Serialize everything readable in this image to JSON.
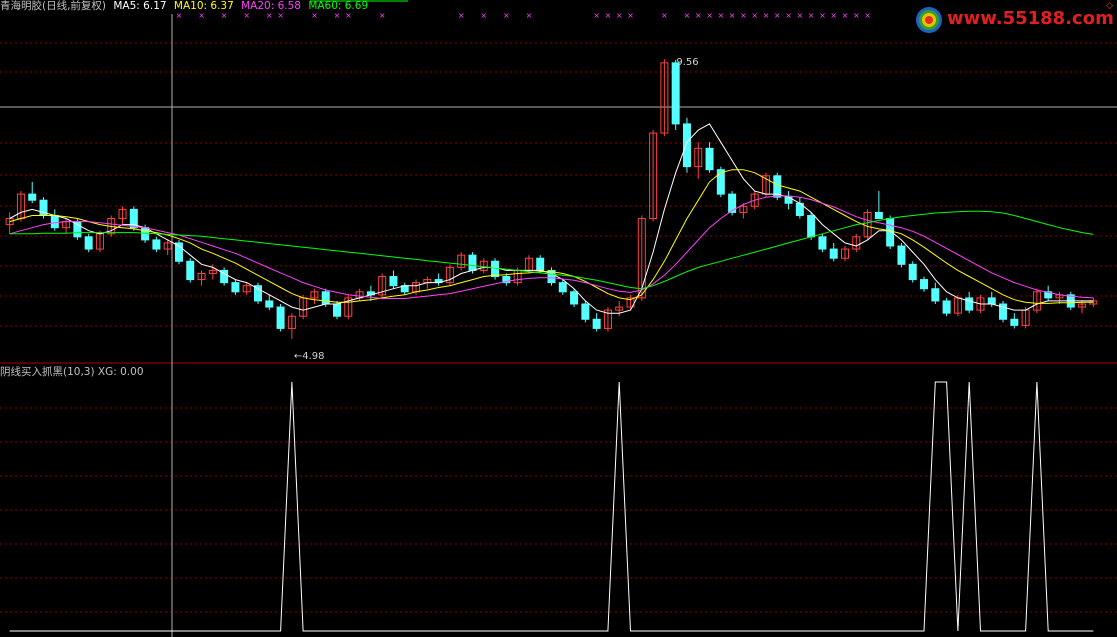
{
  "header": {
    "stock_name": "青海明胶(日线,前复权)",
    "ma5": "MA5: 6.17",
    "ma10": "MA10: 6.37",
    "ma20": "MA20: 6.58",
    "ma60": "MA60: 6.69"
  },
  "indicator_header": {
    "name": "阴线买入抓黑(10,3)",
    "xg": "XG: 0.00"
  },
  "logo": {
    "text": "www.55188.com"
  },
  "annotations": {
    "high_label": "9.56",
    "low_label": "4.98"
  },
  "colors": {
    "up": "#ff4040",
    "down": "#54ffff",
    "ma5": "#ffffff",
    "ma10": "#ffff00",
    "ma20": "#ff40ff",
    "ma60": "#00ff00",
    "grid": "#8b0000",
    "signal_marker": "#ff40ff",
    "indicator_line": "#ffffff"
  },
  "chart_data": [
    {
      "type": "candlestick",
      "title": "青海明胶(日线,前复权)",
      "ylim": [
        4.6,
        10.3
      ],
      "annotations": [
        {
          "label": "9.56",
          "type": "high"
        },
        {
          "label": "4.98",
          "type": "low"
        }
      ],
      "ohlc": [
        [
          6.85,
          7.05,
          6.7,
          6.95
        ],
        [
          6.95,
          7.4,
          6.9,
          7.35
        ],
        [
          7.35,
          7.55,
          7.2,
          7.25
        ],
        [
          7.25,
          7.3,
          6.95,
          7.0
        ],
        [
          7.0,
          7.1,
          6.75,
          6.8
        ],
        [
          6.8,
          6.95,
          6.7,
          6.9
        ],
        [
          6.9,
          6.95,
          6.6,
          6.65
        ],
        [
          6.65,
          6.7,
          6.4,
          6.45
        ],
        [
          6.45,
          6.75,
          6.4,
          6.7
        ],
        [
          6.7,
          7.0,
          6.65,
          6.95
        ],
        [
          6.95,
          7.15,
          6.85,
          7.1
        ],
        [
          7.1,
          7.15,
          6.75,
          6.8
        ],
        [
          6.8,
          6.85,
          6.55,
          6.6
        ],
        [
          6.6,
          6.65,
          6.4,
          6.45
        ],
        [
          6.45,
          6.6,
          6.35,
          6.55
        ],
        [
          6.55,
          6.6,
          6.2,
          6.25
        ],
        [
          6.25,
          6.3,
          5.9,
          5.95
        ],
        [
          5.95,
          6.1,
          5.85,
          6.05
        ],
        [
          6.05,
          6.2,
          5.95,
          6.1
        ],
        [
          6.1,
          6.15,
          5.85,
          5.9
        ],
        [
          5.9,
          5.95,
          5.7,
          5.75
        ],
        [
          5.75,
          5.9,
          5.7,
          5.85
        ],
        [
          5.85,
          5.9,
          5.55,
          5.6
        ],
        [
          5.6,
          5.7,
          5.45,
          5.5
        ],
        [
          5.5,
          5.55,
          5.1,
          5.15
        ],
        [
          5.15,
          5.4,
          4.98,
          5.35
        ],
        [
          5.35,
          5.7,
          5.3,
          5.65
        ],
        [
          5.65,
          5.8,
          5.55,
          5.75
        ],
        [
          5.75,
          5.8,
          5.5,
          5.55
        ],
        [
          5.55,
          5.6,
          5.3,
          5.35
        ],
        [
          5.35,
          5.7,
          5.3,
          5.65
        ],
        [
          5.65,
          5.8,
          5.6,
          5.75
        ],
        [
          5.75,
          5.85,
          5.6,
          5.7
        ],
        [
          5.7,
          6.05,
          5.65,
          6.0
        ],
        [
          6.0,
          6.1,
          5.8,
          5.85
        ],
        [
          5.85,
          5.9,
          5.7,
          5.75
        ],
        [
          5.75,
          5.95,
          5.7,
          5.9
        ],
        [
          5.9,
          6.0,
          5.8,
          5.95
        ],
        [
          5.95,
          6.05,
          5.85,
          5.9
        ],
        [
          5.9,
          6.2,
          5.85,
          6.15
        ],
        [
          6.15,
          6.4,
          6.1,
          6.35
        ],
        [
          6.35,
          6.4,
          6.05,
          6.1
        ],
        [
          6.1,
          6.3,
          6.05,
          6.25
        ],
        [
          6.25,
          6.3,
          5.95,
          6.0
        ],
        [
          6.0,
          6.05,
          5.85,
          5.9
        ],
        [
          5.9,
          6.15,
          5.85,
          6.1
        ],
        [
          6.1,
          6.35,
          6.05,
          6.3
        ],
        [
          6.3,
          6.35,
          6.05,
          6.1
        ],
        [
          6.1,
          6.15,
          5.85,
          5.9
        ],
        [
          5.9,
          5.95,
          5.7,
          5.75
        ],
        [
          5.75,
          5.8,
          5.5,
          5.55
        ],
        [
          5.55,
          5.6,
          5.25,
          5.3
        ],
        [
          5.3,
          5.4,
          5.1,
          5.15
        ],
        [
          5.15,
          5.5,
          5.1,
          5.45
        ],
        [
          5.45,
          5.6,
          5.35,
          5.5
        ],
        [
          5.5,
          5.7,
          5.45,
          5.65
        ],
        [
          5.65,
          7.0,
          5.6,
          6.95
        ],
        [
          6.95,
          8.4,
          6.9,
          8.35
        ],
        [
          8.35,
          9.56,
          8.3,
          9.5
        ],
        [
          9.5,
          9.55,
          8.4,
          8.5
        ],
        [
          8.5,
          8.6,
          7.7,
          7.8
        ],
        [
          7.8,
          8.2,
          7.6,
          8.1
        ],
        [
          8.1,
          8.2,
          7.7,
          7.75
        ],
        [
          7.75,
          7.8,
          7.3,
          7.35
        ],
        [
          7.35,
          7.4,
          7.0,
          7.05
        ],
        [
          7.05,
          7.2,
          6.95,
          7.15
        ],
        [
          7.15,
          7.4,
          7.1,
          7.35
        ],
        [
          7.35,
          7.7,
          7.3,
          7.65
        ],
        [
          7.65,
          7.7,
          7.25,
          7.3
        ],
        [
          7.3,
          7.4,
          7.1,
          7.2
        ],
        [
          7.2,
          7.3,
          6.95,
          7.0
        ],
        [
          7.0,
          7.05,
          6.6,
          6.65
        ],
        [
          6.65,
          6.7,
          6.4,
          6.45
        ],
        [
          6.45,
          6.55,
          6.25,
          6.3
        ],
        [
          6.3,
          6.5,
          6.25,
          6.45
        ],
        [
          6.45,
          6.7,
          6.4,
          6.65
        ],
        [
          6.65,
          7.1,
          6.6,
          7.05
        ],
        [
          7.05,
          7.4,
          6.95,
          6.95
        ],
        [
          6.95,
          7.0,
          6.45,
          6.5
        ],
        [
          6.5,
          6.55,
          6.15,
          6.2
        ],
        [
          6.2,
          6.25,
          5.9,
          5.95
        ],
        [
          5.95,
          6.0,
          5.75,
          5.8
        ],
        [
          5.8,
          5.9,
          5.55,
          5.6
        ],
        [
          5.6,
          5.65,
          5.35,
          5.4
        ],
        [
          5.4,
          5.7,
          5.35,
          5.65
        ],
        [
          5.65,
          5.75,
          5.4,
          5.45
        ],
        [
          5.45,
          5.7,
          5.4,
          5.65
        ],
        [
          5.65,
          5.75,
          5.5,
          5.55
        ],
        [
          5.55,
          5.6,
          5.25,
          5.3
        ],
        [
          5.3,
          5.4,
          5.15,
          5.2
        ],
        [
          5.2,
          5.5,
          5.15,
          5.45
        ],
        [
          5.45,
          5.8,
          5.4,
          5.75
        ],
        [
          5.75,
          5.85,
          5.6,
          5.65
        ],
        [
          5.65,
          5.75,
          5.55,
          5.7
        ],
        [
          5.7,
          5.75,
          5.45,
          5.5
        ],
        [
          5.5,
          5.6,
          5.4,
          5.55
        ],
        [
          5.55,
          5.65,
          5.5,
          5.6
        ]
      ],
      "series": [
        {
          "name": "MA5",
          "values": [
            6.95,
            7.05,
            7.1,
            7.05,
            7.0,
            6.95,
            6.85,
            6.75,
            6.7,
            6.75,
            6.85,
            6.85,
            6.8,
            6.7,
            6.6,
            6.5,
            6.35,
            6.2,
            6.15,
            6.05,
            5.95,
            5.9,
            5.8,
            5.7,
            5.6,
            5.5,
            5.45,
            5.5,
            5.55,
            5.55,
            5.6,
            5.65,
            5.7,
            5.75,
            5.8,
            5.85,
            5.85,
            5.9,
            5.9,
            5.95,
            6.05,
            6.1,
            6.15,
            6.15,
            6.1,
            6.1,
            6.1,
            6.1,
            6.05,
            5.95,
            5.8,
            5.6,
            5.45,
            5.4,
            5.4,
            5.45,
            5.8,
            6.4,
            7.1,
            7.7,
            8.2,
            8.4,
            8.5,
            8.2,
            7.9,
            7.6,
            7.4,
            7.35,
            7.35,
            7.3,
            7.2,
            7.05,
            6.85,
            6.7,
            6.55,
            6.5,
            6.6,
            6.75,
            6.75,
            6.6,
            6.4,
            6.2,
            5.95,
            5.75,
            5.65,
            5.6,
            5.55,
            5.55,
            5.5,
            5.45,
            5.45,
            5.55,
            5.6,
            5.6,
            5.6,
            5.6,
            5.6
          ]
        },
        {
          "name": "MA10",
          "values": [
            6.9,
            6.95,
            7.0,
            7.0,
            7.0,
            6.98,
            6.95,
            6.9,
            6.85,
            6.82,
            6.8,
            6.78,
            6.75,
            6.72,
            6.68,
            6.62,
            6.55,
            6.45,
            6.38,
            6.3,
            6.22,
            6.12,
            6.02,
            5.92,
            5.82,
            5.72,
            5.65,
            5.62,
            5.6,
            5.58,
            5.58,
            5.6,
            5.62,
            5.65,
            5.68,
            5.7,
            5.75,
            5.78,
            5.82,
            5.85,
            5.9,
            5.95,
            6.0,
            6.02,
            6.03,
            6.05,
            6.06,
            6.08,
            6.08,
            6.05,
            6.0,
            5.92,
            5.82,
            5.72,
            5.65,
            5.62,
            5.7,
            5.95,
            6.25,
            6.6,
            6.95,
            7.25,
            7.55,
            7.7,
            7.75,
            7.75,
            7.7,
            7.6,
            7.5,
            7.45,
            7.4,
            7.3,
            7.2,
            7.1,
            7.0,
            6.9,
            6.82,
            6.78,
            6.75,
            6.7,
            6.6,
            6.48,
            6.35,
            6.22,
            6.1,
            6.0,
            5.9,
            5.8,
            5.7,
            5.62,
            5.58,
            5.56,
            5.56,
            5.57,
            5.57,
            5.58,
            5.58
          ]
        },
        {
          "name": "MA20",
          "values": [
            6.7,
            6.75,
            6.8,
            6.85,
            6.88,
            6.9,
            6.9,
            6.9,
            6.88,
            6.86,
            6.84,
            6.82,
            6.8,
            6.76,
            6.72,
            6.68,
            6.62,
            6.56,
            6.5,
            6.44,
            6.38,
            6.3,
            6.22,
            6.14,
            6.06,
            5.98,
            5.9,
            5.84,
            5.78,
            5.74,
            5.7,
            5.68,
            5.66,
            5.64,
            5.64,
            5.64,
            5.66,
            5.68,
            5.7,
            5.72,
            5.76,
            5.8,
            5.84,
            5.88,
            5.92,
            5.95,
            5.97,
            5.98,
            5.98,
            5.96,
            5.94,
            5.9,
            5.85,
            5.8,
            5.76,
            5.74,
            5.78,
            5.88,
            6.02,
            6.2,
            6.4,
            6.6,
            6.8,
            6.95,
            7.08,
            7.18,
            7.25,
            7.3,
            7.32,
            7.32,
            7.3,
            7.26,
            7.2,
            7.14,
            7.06,
            6.98,
            6.92,
            6.88,
            6.84,
            6.8,
            6.74,
            6.66,
            6.56,
            6.46,
            6.36,
            6.26,
            6.16,
            6.06,
            5.98,
            5.9,
            5.84,
            5.78,
            5.74,
            5.7,
            5.68,
            5.66,
            5.65
          ]
        },
        {
          "name": "MA60",
          "values": [
            6.7,
            6.7,
            6.7,
            6.71,
            6.71,
            6.71,
            6.72,
            6.72,
            6.72,
            6.72,
            6.72,
            6.72,
            6.71,
            6.7,
            6.69,
            6.68,
            6.67,
            6.66,
            6.64,
            6.62,
            6.6,
            6.58,
            6.56,
            6.54,
            6.52,
            6.5,
            6.48,
            6.46,
            6.44,
            6.42,
            6.4,
            6.38,
            6.36,
            6.34,
            6.32,
            6.3,
            6.28,
            6.26,
            6.24,
            6.22,
            6.2,
            6.18,
            6.16,
            6.14,
            6.12,
            6.1,
            6.08,
            6.06,
            6.04,
            6.02,
            6.0,
            5.97,
            5.94,
            5.9,
            5.86,
            5.82,
            5.8,
            5.85,
            5.92,
            6.0,
            6.08,
            6.15,
            6.2,
            6.25,
            6.3,
            6.35,
            6.4,
            6.45,
            6.5,
            6.55,
            6.6,
            6.65,
            6.7,
            6.75,
            6.8,
            6.85,
            6.88,
            6.92,
            6.95,
            6.98,
            7.0,
            7.02,
            7.04,
            7.05,
            7.06,
            7.07,
            7.07,
            7.06,
            7.04,
            7.0,
            6.95,
            6.9,
            6.85,
            6.8,
            6.76,
            6.72,
            6.69
          ]
        }
      ],
      "signal_markers_x": [
        15,
        17,
        19,
        21,
        23,
        24,
        27,
        29,
        30,
        33,
        40,
        42,
        44,
        46,
        52,
        53,
        54,
        55,
        58,
        60,
        61,
        62,
        63,
        64,
        65,
        66,
        67,
        68,
        69,
        70,
        71,
        72,
        73,
        74,
        75,
        76
      ]
    },
    {
      "type": "line",
      "title": "阴线买入抓黑(10,3)",
      "series": [
        {
          "name": "XG",
          "values": [
            0,
            0,
            0,
            0,
            0,
            0,
            0,
            0,
            0,
            0,
            0,
            0,
            0,
            0,
            0,
            0,
            0,
            0,
            0,
            0,
            0,
            0,
            0,
            0,
            0,
            1,
            0,
            0,
            0,
            0,
            0,
            0,
            0,
            0,
            0,
            0,
            0,
            0,
            0,
            0,
            0,
            0,
            0,
            0,
            0,
            0,
            0,
            0,
            0,
            0,
            0,
            0,
            0,
            0,
            1,
            0,
            0,
            0,
            0,
            0,
            0,
            0,
            0,
            0,
            0,
            0,
            0,
            0,
            0,
            0,
            0,
            0,
            0,
            0,
            0,
            0,
            0,
            0,
            0,
            0,
            0,
            0,
            1,
            1,
            0,
            1,
            0,
            0,
            0,
            0,
            0,
            1,
            0,
            0,
            0,
            0,
            0
          ]
        }
      ],
      "ylim": [
        0,
        1
      ]
    }
  ]
}
